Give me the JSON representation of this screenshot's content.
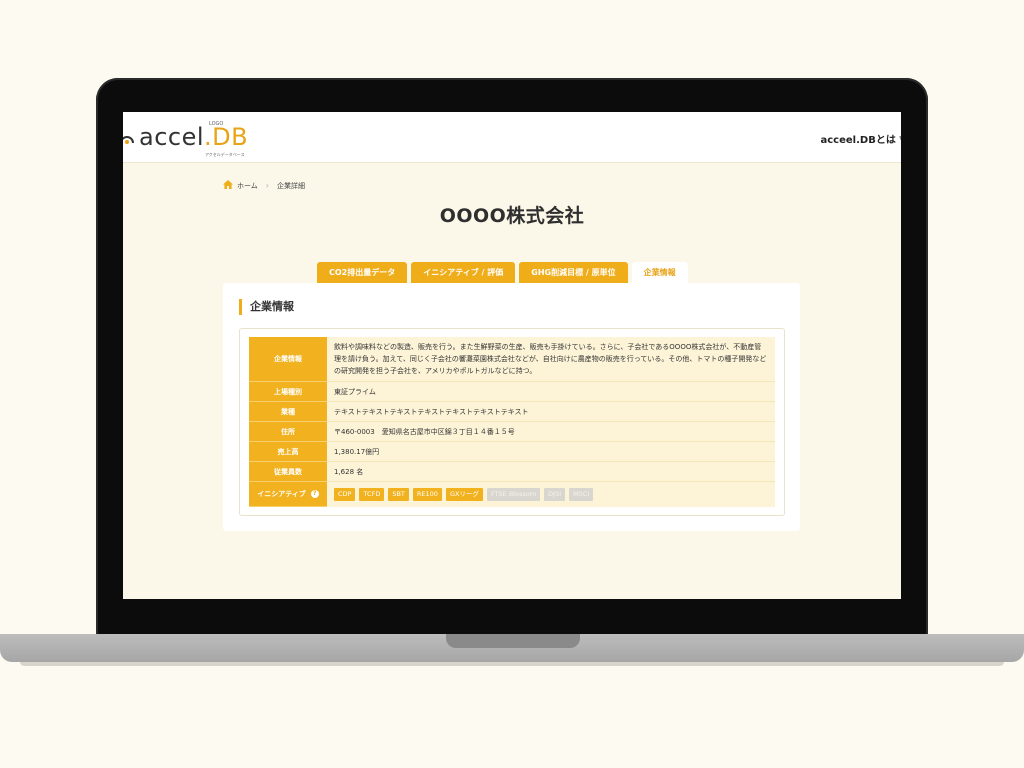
{
  "header": {
    "logo_main": "accel",
    "logo_accent": ".DB",
    "logo_small": "LOGO",
    "logo_sub": "アクセルデータベース",
    "nav_label": "acceel.DBとは ▽"
  },
  "breadcrumb": {
    "home": "ホーム",
    "current": "企業詳細"
  },
  "page": {
    "title": "OOOO株式会社"
  },
  "tabs": [
    {
      "label": "CO2排出量データ",
      "active": false
    },
    {
      "label": "イニシアティブ / 評価",
      "active": false
    },
    {
      "label": "GHG削減目標 / 原単位",
      "active": false
    },
    {
      "label": "企業情報",
      "active": true
    }
  ],
  "section": {
    "title": "企業情報"
  },
  "info": {
    "rows": [
      {
        "label": "企業情報",
        "value": "飲料や調味料などの製造、販売を行う。また生鮮野菜の生産、販売も手掛けている。さらに、子会社であるOOOO株式会社が、不動産管理を請け負う。加えて、同じく子会社の響灘菜園株式会社などが、自社向けに農産物の販売を行っている。その他、トマトの種子開発などの研究開発を担う子会社を、アメリカやポルトガルなどに持つ。"
      },
      {
        "label": "上場種別",
        "value": "東証プライム"
      },
      {
        "label": "業種",
        "value": "テキストテキストテキストテキストテキストテキストテキスト"
      },
      {
        "label": "住所",
        "value": "〒460-0003　愛知県名古屋市中区錦３丁目１４番１５号"
      },
      {
        "label": "売上高",
        "value": "1,380.17億円"
      },
      {
        "label": "従業員数",
        "value": "1,628 名"
      }
    ],
    "initiative_label": "イニシアティブ",
    "initiatives": [
      {
        "label": "CDP",
        "active": true
      },
      {
        "label": "TCFD",
        "active": true
      },
      {
        "label": "SBT",
        "active": true
      },
      {
        "label": "RE100",
        "active": true
      },
      {
        "label": "GXリーグ",
        "active": true
      },
      {
        "label": "FTSE Blossom",
        "active": false
      },
      {
        "label": "DJSI",
        "active": false
      },
      {
        "label": "MSCI",
        "active": false
      }
    ]
  },
  "colors": {
    "accent": "#f0ad1a",
    "background": "#fdfaf1",
    "table_value_bg": "#fdf4d8",
    "badge_disabled": "#d9d6cf"
  }
}
